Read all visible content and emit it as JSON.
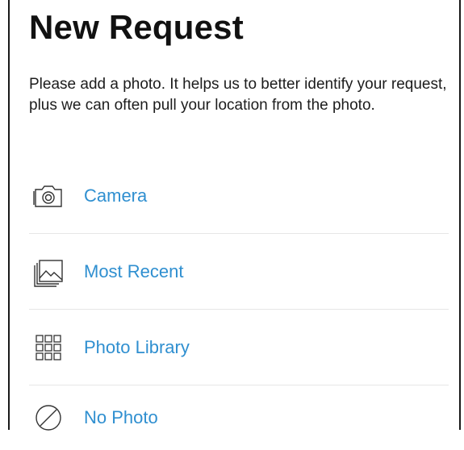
{
  "header": {
    "title": "New Request"
  },
  "intro": {
    "text": "Please add a photo. It helps us to better identify your request, plus we can often pull your location from the photo."
  },
  "options": [
    {
      "label": "Camera",
      "icon": "camera-icon"
    },
    {
      "label": "Most Recent",
      "icon": "photo-stack-icon"
    },
    {
      "label": "Photo Library",
      "icon": "grid-icon"
    },
    {
      "label": "No Photo",
      "icon": "no-photo-icon"
    }
  ],
  "colors": {
    "accent": "#2f8fd0",
    "text": "#111111",
    "divider": "#e6e6e6"
  }
}
